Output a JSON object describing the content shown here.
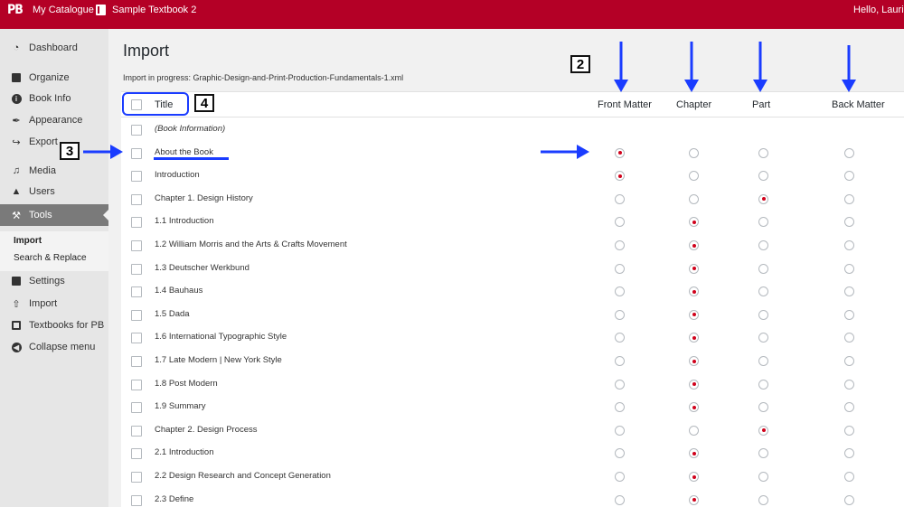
{
  "topbar": {
    "logo": "PB",
    "my_catalogue": "My Catalogue",
    "book_title": "Sample Textbook 2",
    "greeting": "Hello, Lauri"
  },
  "sidebar": {
    "items": [
      {
        "label": "Dashboard",
        "icon": "dashboard-icon"
      },
      {
        "label": "Organize",
        "icon": "organize-icon"
      },
      {
        "label": "Book Info",
        "icon": "info-icon"
      },
      {
        "label": "Appearance",
        "icon": "appearance-icon"
      },
      {
        "label": "Export",
        "icon": "export-icon"
      },
      {
        "label": "Media",
        "icon": "media-icon"
      },
      {
        "label": "Users",
        "icon": "users-icon"
      },
      {
        "label": "Tools",
        "icon": "tools-icon"
      },
      {
        "label": "Settings",
        "icon": "settings-icon"
      },
      {
        "label": "Import",
        "icon": "import-icon"
      },
      {
        "label": "Textbooks for PB",
        "icon": "textbooks-icon"
      },
      {
        "label": "Collapse menu",
        "icon": "collapse-icon"
      }
    ],
    "submenu": [
      "Import",
      "Search & Replace"
    ]
  },
  "main": {
    "title": "Import",
    "progress": "Import in progress: Graphic-Design-and-Print-Production-Fundamentals-1.xml",
    "columns": {
      "title": "Title",
      "front_matter": "Front Matter",
      "chapter": "Chapter",
      "part": "Part",
      "back_matter": "Back Matter"
    },
    "rows": [
      {
        "title": "(Book Information)",
        "type": null,
        "italic": true
      },
      {
        "title": "About the Book",
        "type": "front_matter"
      },
      {
        "title": "Introduction",
        "type": "front_matter"
      },
      {
        "title": "Chapter 1. Design History",
        "type": "part"
      },
      {
        "title": "1.1 Introduction",
        "type": "chapter"
      },
      {
        "title": "1.2 William Morris and the Arts & Crafts Movement",
        "type": "chapter"
      },
      {
        "title": "1.3 Deutscher Werkbund",
        "type": "chapter"
      },
      {
        "title": "1.4 Bauhaus",
        "type": "chapter"
      },
      {
        "title": "1.5 Dada",
        "type": "chapter"
      },
      {
        "title": "1.6 International Typographic Style",
        "type": "chapter"
      },
      {
        "title": "1.7 Late Modern | New York Style",
        "type": "chapter"
      },
      {
        "title": "1.8 Post Modern",
        "type": "chapter"
      },
      {
        "title": "1.9 Summary",
        "type": "chapter"
      },
      {
        "title": "Chapter 2. Design Process",
        "type": "part"
      },
      {
        "title": "2.1 Introduction",
        "type": "chapter"
      },
      {
        "title": "2.2 Design Research and Concept Generation",
        "type": "chapter"
      },
      {
        "title": "2.3 Define",
        "type": "chapter"
      }
    ]
  },
  "annotations": {
    "label_2": "2",
    "label_3": "3",
    "label_4": "4",
    "arrow_color": "#1a3cff"
  }
}
